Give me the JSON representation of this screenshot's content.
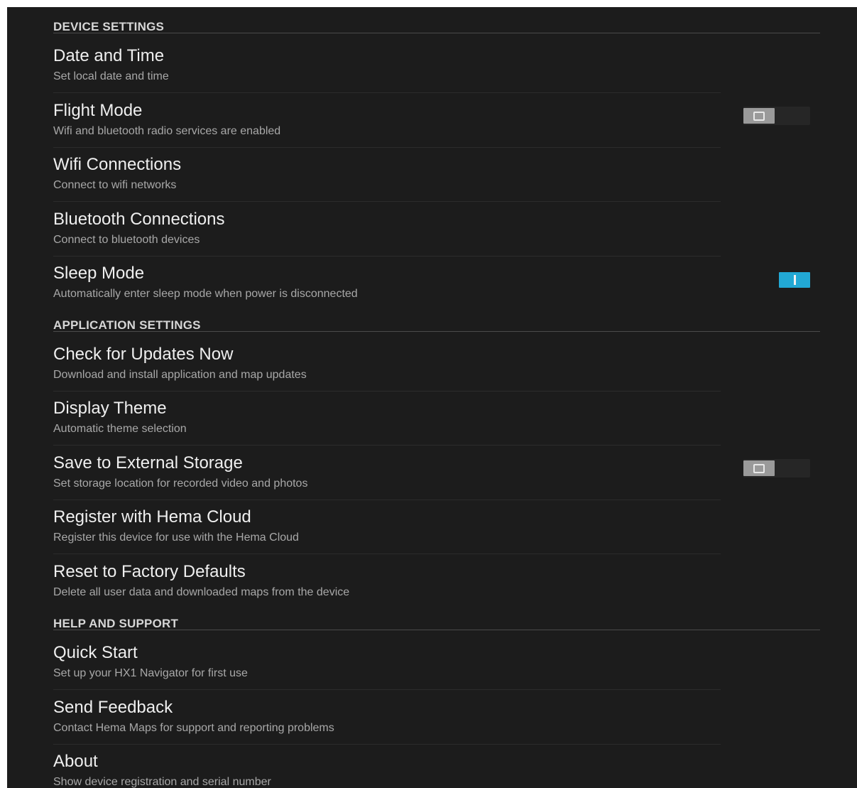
{
  "sections": [
    {
      "header": "DEVICE SETTINGS",
      "items": [
        {
          "title": "Date and Time",
          "subtitle": "Set local date and time"
        },
        {
          "title": "Flight Mode",
          "subtitle": "Wifi and bluetooth radio services are enabled",
          "toggle": "off"
        },
        {
          "title": "Wifi Connections",
          "subtitle": "Connect to wifi networks"
        },
        {
          "title": "Bluetooth Connections",
          "subtitle": "Connect to bluetooth devices"
        },
        {
          "title": "Sleep Mode",
          "subtitle": "Automatically enter sleep mode when power is disconnected",
          "toggle": "on"
        }
      ]
    },
    {
      "header": "APPLICATION SETTINGS",
      "items": [
        {
          "title": "Check for Updates Now",
          "subtitle": "Download and install application and map updates"
        },
        {
          "title": "Display Theme",
          "subtitle": "Automatic theme selection"
        },
        {
          "title": "Save to External Storage",
          "subtitle": "Set storage location for recorded video and photos",
          "toggle": "off"
        },
        {
          "title": "Register with Hema Cloud",
          "subtitle": "Register this device for use with the Hema Cloud"
        },
        {
          "title": "Reset to Factory Defaults",
          "subtitle": "Delete all user data and downloaded maps from the device"
        }
      ]
    },
    {
      "header": "HELP AND SUPPORT",
      "items": [
        {
          "title": "Quick Start",
          "subtitle": "Set up your HX1 Navigator for first use"
        },
        {
          "title": "Send Feedback",
          "subtitle": "Contact Hema Maps for support and reporting problems"
        },
        {
          "title": "About",
          "subtitle": "Show device registration and serial number"
        }
      ]
    }
  ],
  "colors": {
    "background": "#1c1c1c",
    "toggle_on": "#22a8d4",
    "toggle_off": "#9a9a9a"
  }
}
